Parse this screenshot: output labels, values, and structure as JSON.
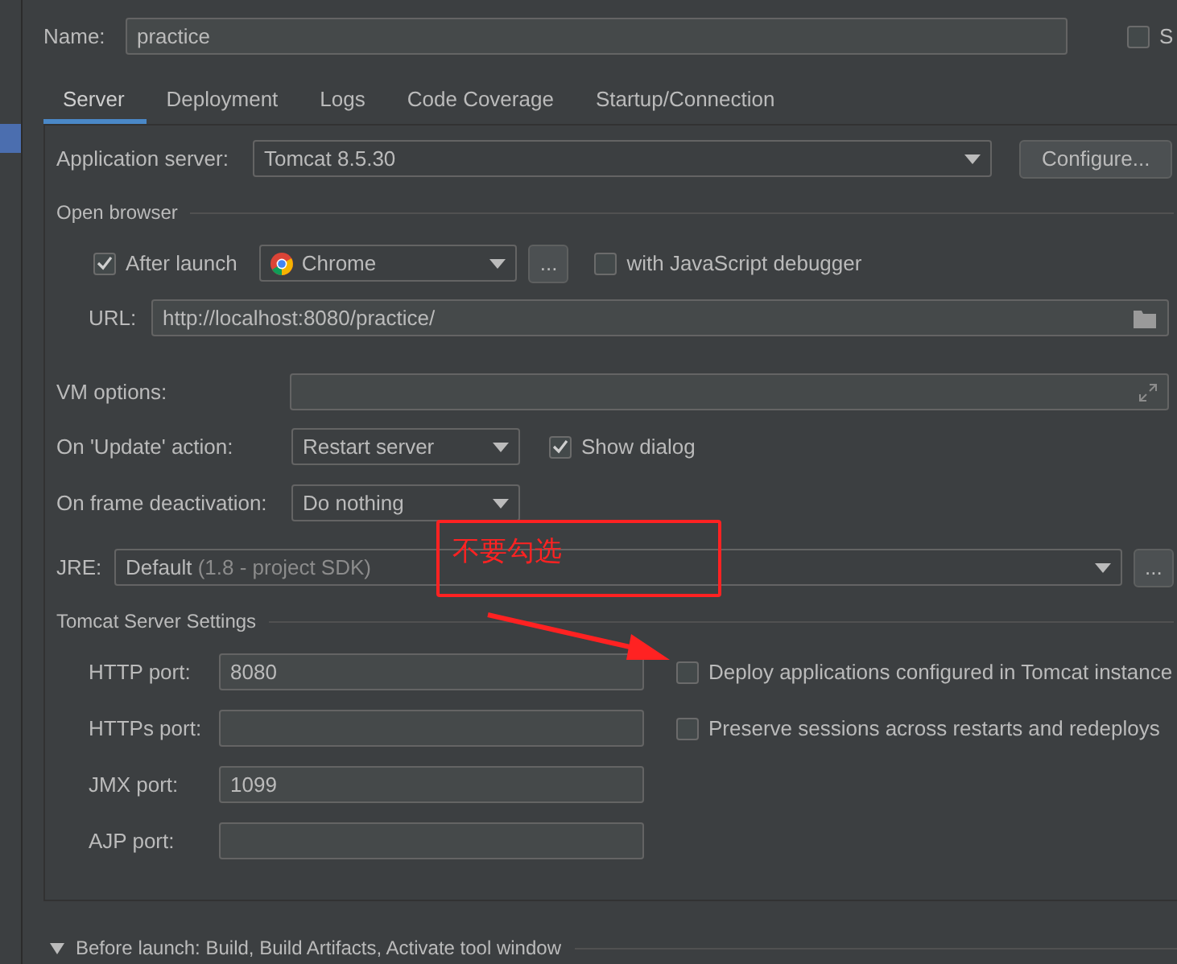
{
  "name_field": {
    "label": "Name:",
    "value": "practice"
  },
  "share_option": {
    "label": "S",
    "checked": false
  },
  "tabs": [
    {
      "label": "Server",
      "selected": true
    },
    {
      "label": "Deployment",
      "selected": false
    },
    {
      "label": "Logs",
      "selected": false
    },
    {
      "label": "Code Coverage",
      "selected": false
    },
    {
      "label": "Startup/Connection",
      "selected": false
    }
  ],
  "server": {
    "application_server": {
      "label": "Application server:",
      "value": "Tomcat 8.5.30",
      "button": "Configure..."
    },
    "open_browser": {
      "title": "Open browser",
      "after_launch": {
        "label": "After launch",
        "checked": true
      },
      "browser": "Chrome",
      "more": "...",
      "js_debugger": {
        "label": "with JavaScript debugger",
        "checked": false
      },
      "url": {
        "label": "URL:",
        "value": "http://localhost:8080/practice/"
      }
    },
    "vm_options": {
      "label": "VM options:"
    },
    "on_update": {
      "label": "On 'Update' action:",
      "value": "Restart server",
      "show_dialog": {
        "label": "Show dialog",
        "checked": true
      }
    },
    "on_frame_deactivation": {
      "label": "On frame deactivation:",
      "value": "Do nothing"
    },
    "jre": {
      "label": "JRE:",
      "value": "Default",
      "hint": "(1.8 - project SDK)",
      "more": "..."
    },
    "tomcat_settings": {
      "title": "Tomcat Server Settings",
      "ports": [
        {
          "label": "HTTP port:",
          "value": "8080"
        },
        {
          "label": "HTTPs port:"
        },
        {
          "label": "JMX port:",
          "value": "1099"
        },
        {
          "label": "AJP port:"
        }
      ],
      "options": [
        {
          "label": "Deploy applications configured in Tomcat instance",
          "checked": false
        },
        {
          "label": "Preserve sessions across restarts and redeploys",
          "checked": false
        }
      ]
    }
  },
  "before_launch": {
    "label": "Before launch: Build, Build Artifacts, Activate tool window",
    "expanded": true
  },
  "annotation": {
    "text": "不要勾选"
  }
}
